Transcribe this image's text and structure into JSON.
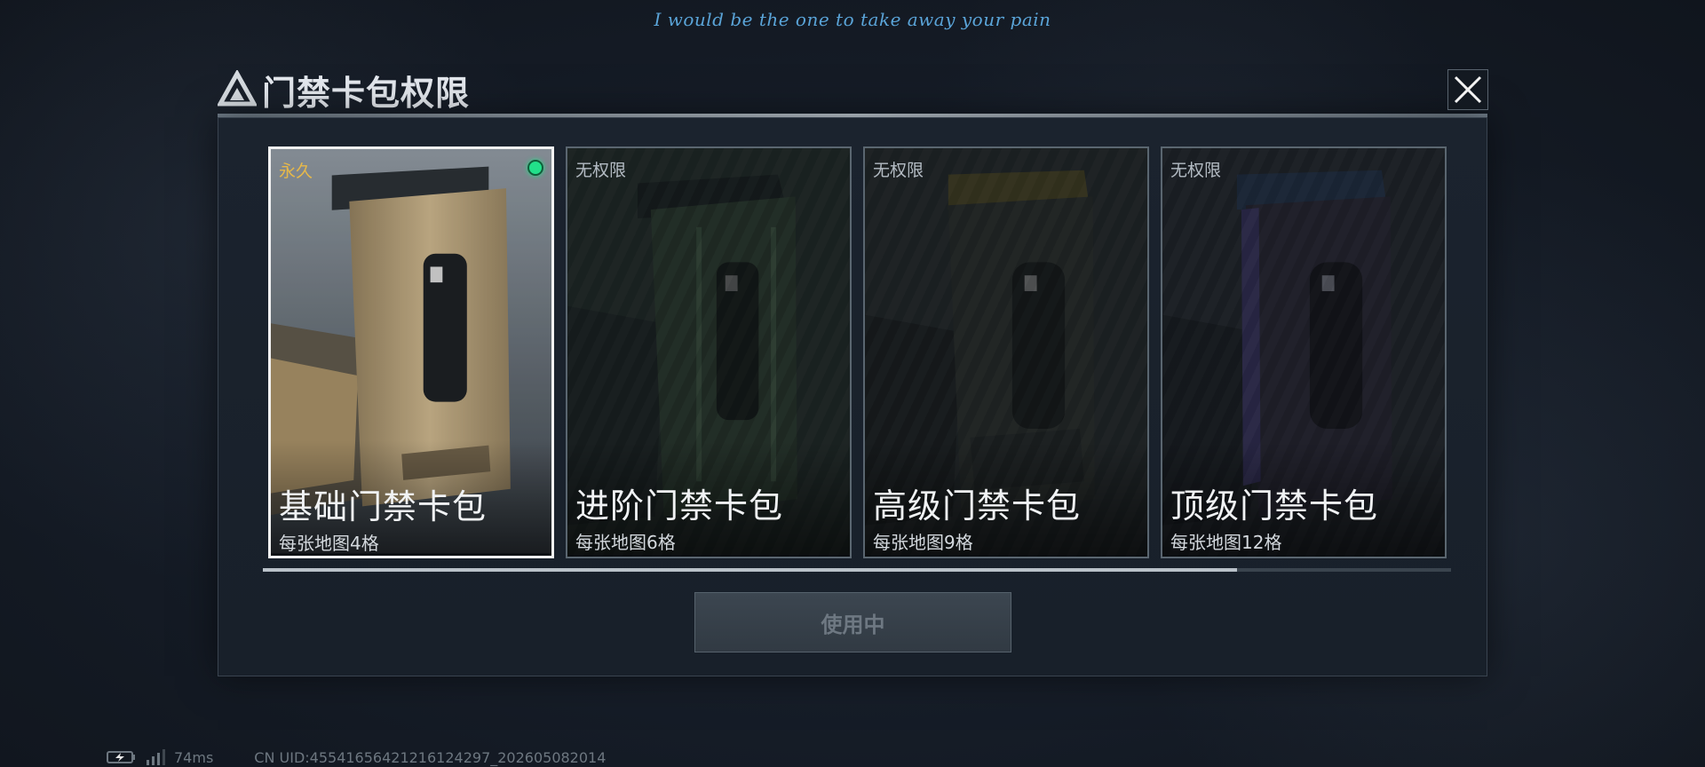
{
  "subtitle": "I would be the one to take away your pain",
  "dialog": {
    "title": "门禁卡包权限",
    "use_button_label": "使用中",
    "scroll_fraction": 0.82
  },
  "cards": [
    {
      "status": "永久",
      "name": "基础门禁卡包",
      "desc": "每张地图4格",
      "selected": true,
      "equipped": true,
      "color": "#b9a27c"
    },
    {
      "status": "无权限",
      "name": "进阶门禁卡包",
      "desc": "每张地图6格",
      "selected": false,
      "equipped": false,
      "color": "#2e3b2f"
    },
    {
      "status": "无权限",
      "name": "高级门禁卡包",
      "desc": "每张地图9格",
      "selected": false,
      "equipped": false,
      "color": "#2f3230"
    },
    {
      "status": "无权限",
      "name": "顶级门禁卡包",
      "desc": "每张地图12格",
      "selected": false,
      "equipped": false,
      "color": "#2c2a36"
    }
  ],
  "footer": {
    "ping": "74ms",
    "uid": "CN UID:45541656421216124297_202605082014"
  },
  "colors": {
    "accent_green": "#22e08a",
    "permanent_gold": "#e6b84a",
    "subtitle_blue": "#5aa4d8"
  }
}
